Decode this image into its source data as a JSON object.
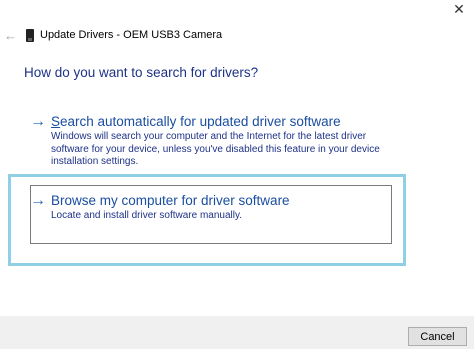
{
  "window": {
    "close_glyph": "✕"
  },
  "titlebar": {
    "back_glyph": "←",
    "title": "Update Drivers - OEM USB3 Camera"
  },
  "main": {
    "question": "How do you want to search for drivers?",
    "options": [
      {
        "arrow_glyph": "→",
        "title": "Search automatically for updated driver software",
        "description": "Windows will search your computer and the Internet for the latest driver software for your device, unless you've disabled this feature in your device installation settings."
      },
      {
        "arrow_glyph": "→",
        "title": "Browse my computer for driver software",
        "description": "Locate and install driver software manually."
      }
    ]
  },
  "footer": {
    "cancel_label": "Cancel"
  },
  "colors": {
    "highlight_border": "#8fd0e4",
    "link_blue": "#1a4ea0",
    "heading_blue": "#1e3287",
    "footer_bg": "#f0f0f0"
  }
}
